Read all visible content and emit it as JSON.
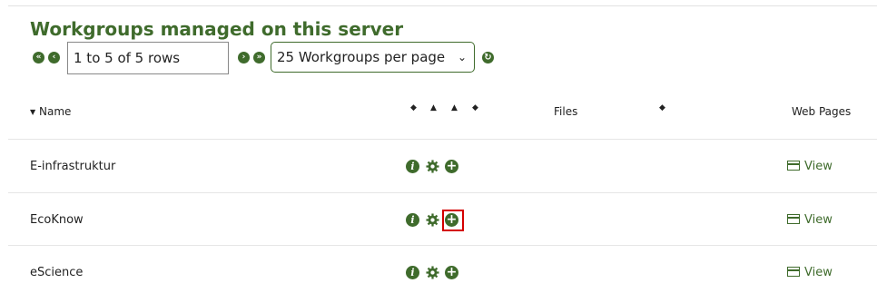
{
  "page": {
    "title": "Workgroups managed on this server"
  },
  "pager": {
    "rows_text": "1 to 5 of 5 rows",
    "per_page_selected": "25 Workgroups per page"
  },
  "table": {
    "headers": {
      "name": "Name",
      "files": "Files",
      "web_pages": "Web Pages"
    },
    "rows": [
      {
        "name": "E-infrastruktur",
        "web_link": "View"
      },
      {
        "name": "EcoKnow",
        "web_link": "View"
      },
      {
        "name": "eScience",
        "web_link": "View"
      }
    ]
  },
  "colors": {
    "accent": "#3f6b2c",
    "highlight": "#d40000"
  },
  "icons": [
    "first-page-icon",
    "prev-page-icon",
    "next-page-icon",
    "last-page-icon",
    "refresh-icon",
    "info-icon",
    "settings-icon",
    "add-icon",
    "web-page-icon"
  ]
}
